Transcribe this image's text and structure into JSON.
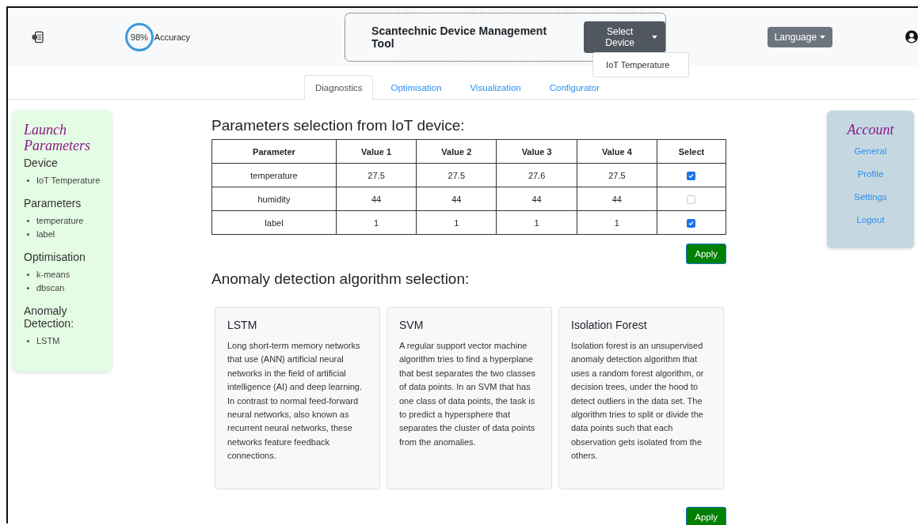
{
  "header": {
    "accuracy": "98%",
    "accuracy_label": "Accuracy",
    "title": "Scantechnic Device Management Tool",
    "device_button": "Select Device",
    "device_menu": [
      "IoT Temperature"
    ],
    "language_button": "Language"
  },
  "tabs": [
    {
      "label": "Diagnostics",
      "selected": true
    },
    {
      "label": "Optimisation",
      "selected": false
    },
    {
      "label": "Visualization",
      "selected": false
    },
    {
      "label": "Configurator",
      "selected": false
    }
  ],
  "launch_panel": {
    "title": "Launch Parameters",
    "sections": [
      {
        "heading": "Device",
        "items": [
          "IoT Temperature"
        ]
      },
      {
        "heading": "Parameters",
        "items": [
          "temperature",
          "label"
        ]
      },
      {
        "heading": "Optimisation",
        "items": [
          "k-means",
          "dbscan"
        ]
      },
      {
        "heading": "Anomaly Detection:",
        "items": [
          "LSTM"
        ]
      }
    ]
  },
  "parameters": {
    "title": "Parameters selection from IoT device:",
    "columns": [
      "Parameter",
      "Value 1",
      "Value 2",
      "Value 3",
      "Value 4",
      "Select"
    ],
    "rows": [
      {
        "cells": [
          "temperature",
          "27.5",
          "27.5",
          "27.6",
          "27.5"
        ],
        "checked": true
      },
      {
        "cells": [
          "humidity",
          "44",
          "44",
          "44",
          "44"
        ],
        "checked": false
      },
      {
        "cells": [
          "label",
          "1",
          "1",
          "1",
          "1"
        ],
        "checked": true
      }
    ],
    "apply": "Apply"
  },
  "algorithms": {
    "title": "Anomaly detection algorithm selection:",
    "cards": [
      {
        "name": "LSTM",
        "text": "Long short-term memory networks that use (ANN) artificial neural networks in the field of artificial intelligence (AI) and deep learning. In contrast to normal feed-forward neural networks, also known as recurrent neural networks, these networks feature feedback connections."
      },
      {
        "name": "SVM",
        "text": "A regular support vector machine algorithm tries to find a hyperplane that best separates the two classes of data points. In an SVM that has one class of data points, the task is to predict a hypersphere that separates the cluster of data points from the anomalies."
      },
      {
        "name": "Isolation Forest",
        "text": "Isolation forest is an unsupervised anomaly detection algorithm that uses a random forest algorithm, or decision trees, under the hood to detect outliers in the data set. The algorithm tries to split or divide the data points such that each observation gets isolated from the others."
      }
    ],
    "apply": "Apply"
  },
  "account_panel": {
    "title": "Account",
    "links": [
      "General",
      "Profile",
      "Settings",
      "Logout"
    ]
  }
}
